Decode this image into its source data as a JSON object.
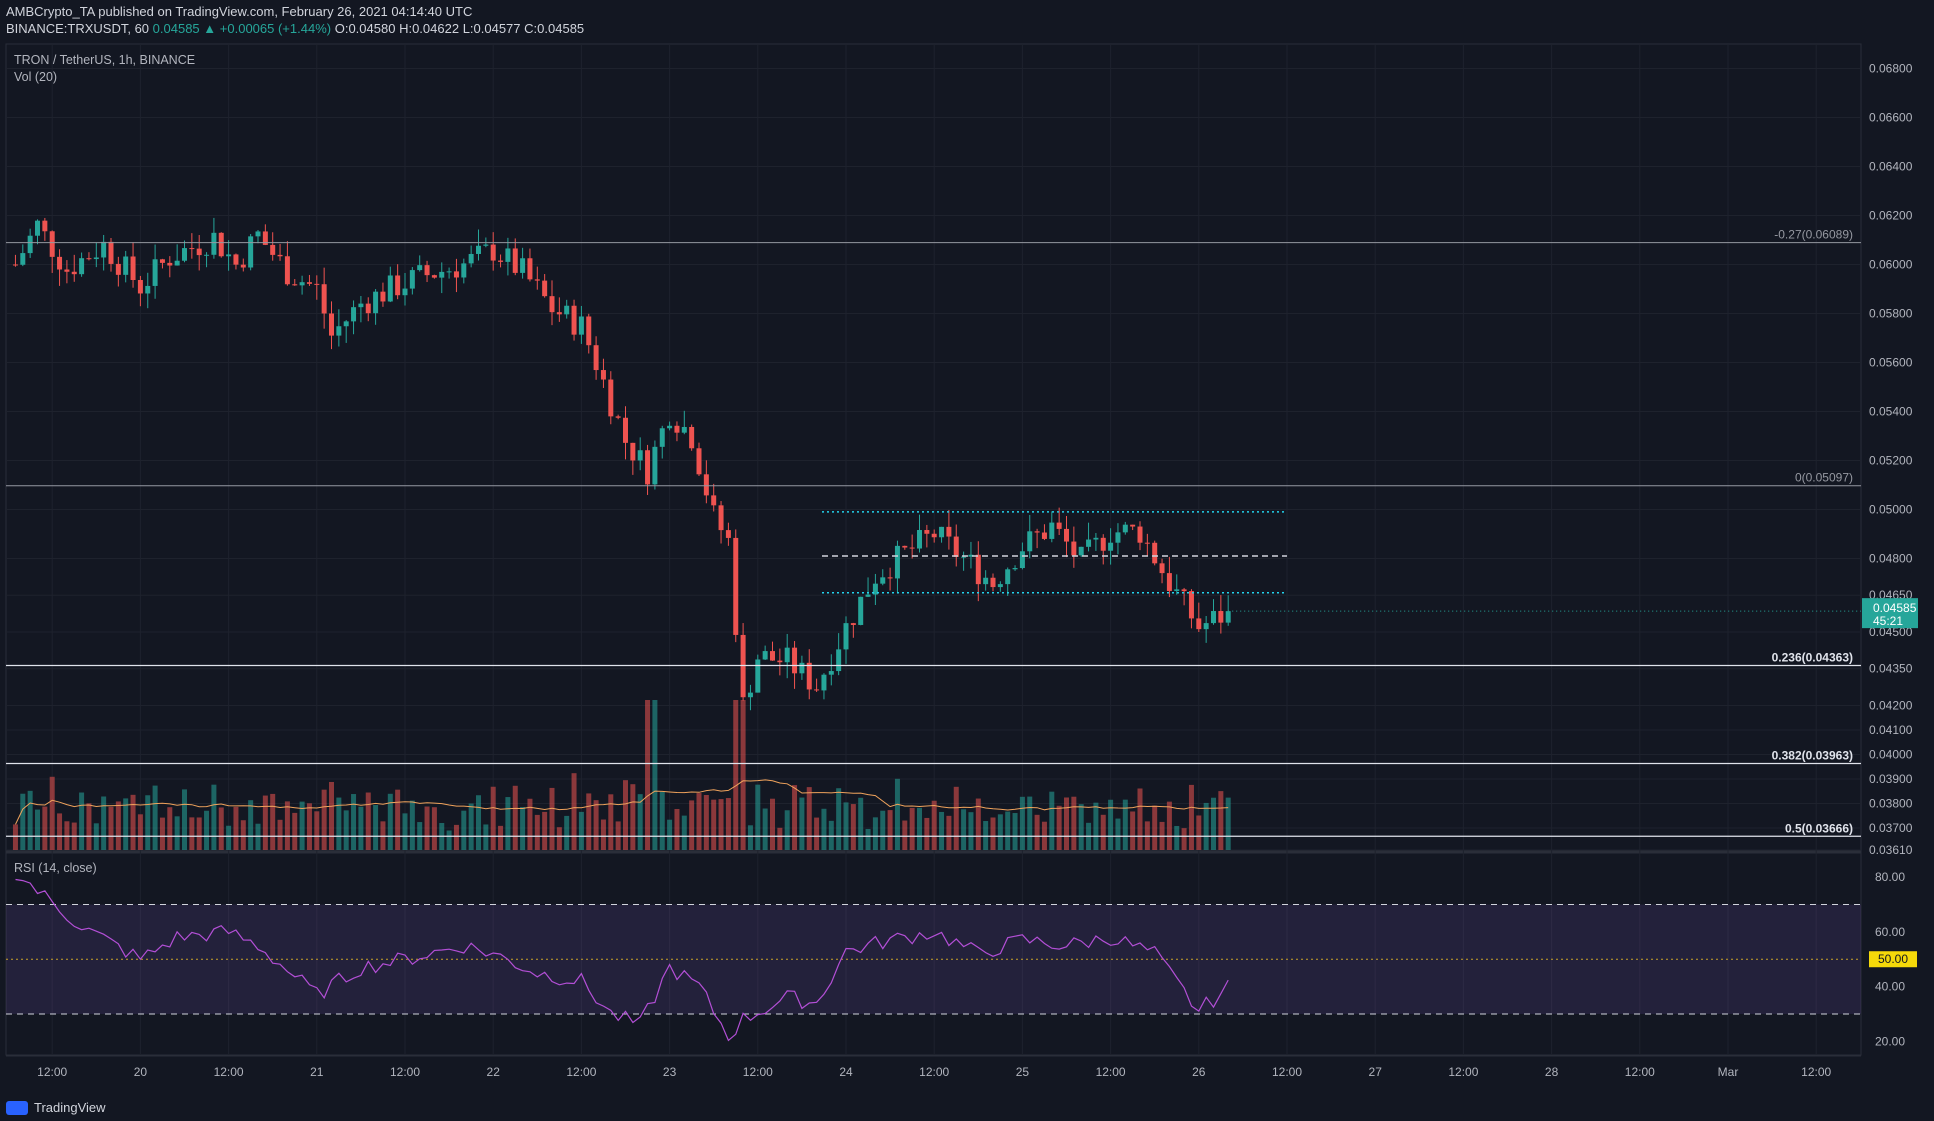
{
  "header": {
    "line1": "AMBCrypto_TA published on TradingView.com, February 26, 2021 04:14:40 UTC",
    "symbol": "BINANCE:TRXUSDT, 60",
    "last": "0.04585",
    "change": "▲ +0.00065 (+1.44%)",
    "o": "O:0.04580",
    "h": "H:0.04622",
    "l": "L:0.04577",
    "c": "C:0.04585"
  },
  "legend": {
    "title": "TRON / TetherUS, 1h, BINANCE",
    "vol": "Vol (20)",
    "rsi": "RSI (14, close)"
  },
  "footer": {
    "brand": "TradingView"
  },
  "colors": {
    "bg": "#131722",
    "up": "#26a69a",
    "down": "#ef5350",
    "cyan": "#22d3ee",
    "rsi": "#b34fd6",
    "vol_ma": "#f0a35c"
  },
  "chart_data": [
    {
      "type": "candlestick",
      "ylim": [
        0.0361,
        0.069
      ],
      "grid": true,
      "price_ticks": [
        "0.06800",
        "0.06600",
        "0.06400",
        "0.06200",
        "0.06000",
        "0.05800",
        "0.05600",
        "0.05400",
        "0.05200",
        "0.05000",
        "0.04800",
        "0.04650",
        "0.04500",
        "0.04350",
        "0.04200",
        "0.04100",
        "0.04000",
        "0.03900",
        "0.03800",
        "0.03700",
        "0.03610"
      ],
      "x_labels": [
        "12:00",
        "20",
        "12:00",
        "21",
        "12:00",
        "22",
        "12:00",
        "23",
        "12:00",
        "24",
        "12:00",
        "25",
        "12:00",
        "26",
        "12:00",
        "27",
        "12:00",
        "28",
        "12:00",
        "Mar",
        "12:00"
      ],
      "last_price": {
        "value": "0.04585",
        "countdown": "45:21"
      },
      "fib_levels": [
        {
          "label": "-0.27(0.06089)",
          "value": 0.06089
        },
        {
          "label": "0(0.05097)",
          "value": 0.05097
        },
        {
          "label": "0.236(0.04363)",
          "value": 0.04363
        },
        {
          "label": "0.382(0.03963)",
          "value": 0.03963
        },
        {
          "label": "0.5(0.03666)",
          "value": 0.03666
        }
      ],
      "range_lines": [
        {
          "value": 0.0499,
          "style": "dotted"
        },
        {
          "value": 0.0481,
          "style": "dashed"
        },
        {
          "value": 0.0466,
          "style": "dotted"
        }
      ],
      "close_path": [
        [
          "19 07:00",
          0.06
        ],
        [
          "19 10:00",
          0.0616
        ],
        [
          "19 14:00",
          0.0598
        ],
        [
          "19 19:00",
          0.0608
        ],
        [
          "20 00:00",
          0.0591
        ],
        [
          "20 04:00",
          0.0603
        ],
        [
          "20 10:00",
          0.0611
        ],
        [
          "20 13:00",
          0.06
        ],
        [
          "20 16:00",
          0.0612
        ],
        [
          "20 20:00",
          0.0597
        ],
        [
          "21 00:00",
          0.059
        ],
        [
          "21 02:00",
          0.0571
        ],
        [
          "21 06:00",
          0.0584
        ],
        [
          "21 10:00",
          0.059
        ],
        [
          "21 14:00",
          0.0595
        ],
        [
          "21 20:00",
          0.06
        ],
        [
          "22 00:00",
          0.0606
        ],
        [
          "22 04:00",
          0.0597
        ],
        [
          "22 08:00",
          0.0582
        ],
        [
          "22 12:00",
          0.0575
        ],
        [
          "22 14:00",
          0.056
        ],
        [
          "22 18:00",
          0.0528
        ],
        [
          "22 21:00",
          0.0516
        ],
        [
          "23 00:00",
          0.054
        ],
        [
          "23 03:00",
          0.053
        ],
        [
          "23 06:00",
          0.0497
        ],
        [
          "23 08:00",
          0.0487
        ],
        [
          "23 10:00",
          0.042
        ],
        [
          "23 12:00",
          0.044
        ],
        [
          "23 16:00",
          0.0438
        ],
        [
          "23 20:00",
          0.0428
        ],
        [
          "24 00:00",
          0.0452
        ],
        [
          "24 04:00",
          0.0473
        ],
        [
          "24 08:00",
          0.0482
        ],
        [
          "24 12:00",
          0.049
        ],
        [
          "24 16:00",
          0.048
        ],
        [
          "24 20:00",
          0.047
        ],
        [
          "25 00:00",
          0.0485
        ],
        [
          "25 04:00",
          0.0493
        ],
        [
          "25 08:00",
          0.0479
        ],
        [
          "25 12:00",
          0.0491
        ],
        [
          "25 16:00",
          0.0491
        ],
        [
          "25 20:00",
          0.047
        ],
        [
          "26 00:00",
          0.0452
        ],
        [
          "26 04:00",
          0.0458
        ]
      ]
    },
    {
      "type": "bar",
      "title": "Vol (20)",
      "note": "hourly volume bars, relative units"
    },
    {
      "type": "line",
      "title": "RSI (14, close)",
      "ylim": [
        15,
        87
      ],
      "y_ticks": [
        "80.00",
        "60.00",
        "40.00",
        "20.00"
      ],
      "mid_label": "50.00",
      "bands": [
        30,
        50,
        70
      ],
      "rsi_path": [
        [
          "19 07:00",
          82
        ],
        [
          "19 10:00",
          75
        ],
        [
          "19 16:00",
          62
        ],
        [
          "20 00:00",
          50
        ],
        [
          "20 05:00",
          58
        ],
        [
          "20 12:00",
          60
        ],
        [
          "20 16:00",
          55
        ],
        [
          "21 00:00",
          37
        ],
        [
          "21 06:00",
          47
        ],
        [
          "21 12:00",
          50
        ],
        [
          "21 20:00",
          55
        ],
        [
          "22 00:00",
          52
        ],
        [
          "22 06:00",
          45
        ],
        [
          "22 12:00",
          42
        ],
        [
          "22 16:00",
          30
        ],
        [
          "22 20:00",
          26
        ],
        [
          "23 00:00",
          47
        ],
        [
          "23 04:00",
          40
        ],
        [
          "23 08:00",
          22
        ],
        [
          "23 10:00",
          28
        ],
        [
          "23 16:00",
          36
        ],
        [
          "23 20:00",
          34
        ],
        [
          "24 00:00",
          53
        ],
        [
          "24 06:00",
          57
        ],
        [
          "24 12:00",
          60
        ],
        [
          "24 18:00",
          52
        ],
        [
          "25 00:00",
          57
        ],
        [
          "25 06:00",
          55
        ],
        [
          "25 12:00",
          58
        ],
        [
          "25 18:00",
          52
        ],
        [
          "26 00:00",
          31
        ],
        [
          "26 05:00",
          42
        ]
      ]
    }
  ]
}
